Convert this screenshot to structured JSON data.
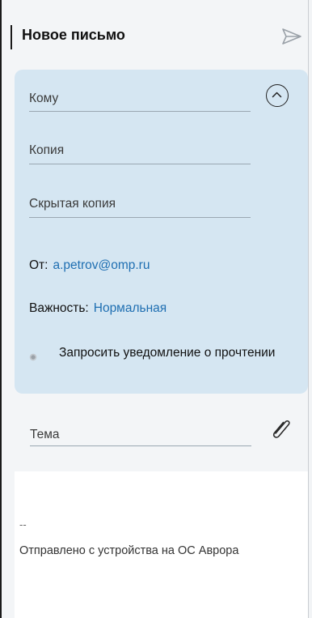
{
  "header": {
    "title": "Новое письмо",
    "send_icon": "send-icon"
  },
  "recipients": {
    "to_label": "Кому",
    "cc_label": "Копия",
    "bcc_label": "Скрытая копия",
    "collapse_icon": "chevron-up-icon"
  },
  "from": {
    "label": "От:",
    "value": "a.petrov@omp.ru"
  },
  "importance": {
    "label": "Важность:",
    "value": "Нормальная"
  },
  "read_receipt": {
    "label": "Запросить уведомление о прочтении",
    "enabled": false
  },
  "subject": {
    "label": "Тема",
    "attach_icon": "paperclip-icon"
  },
  "body": {
    "signature_dash": "--",
    "signature_text": "Отправлено с устройства на ОС Аврора"
  },
  "colors": {
    "fields_background": "#d5e6f2",
    "link": "#1f6fb2",
    "background": "#f3f5f7"
  }
}
